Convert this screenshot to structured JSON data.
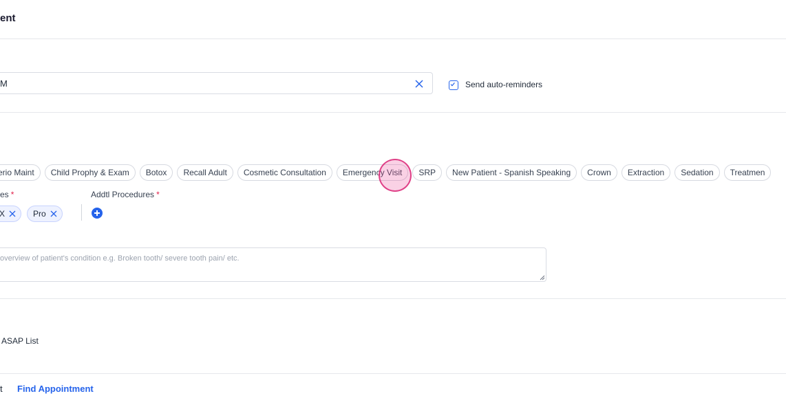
{
  "header": {
    "title": "ent"
  },
  "time_field": {
    "value": "M"
  },
  "reminders": {
    "label": "Send auto-reminders",
    "checked": true
  },
  "appointment_types": [
    "Perio Maint",
    "Child Prophy & Exam",
    "Botox",
    "Recall Adult",
    "Cosmetic Consultation",
    "Emergency Visit",
    "SRP",
    "New Patient - Spanish Speaking",
    "Crown",
    "Extraction",
    "Sedation",
    "Treatmen"
  ],
  "procedures": {
    "label": "es",
    "required_mark": "*",
    "tags": [
      "MX",
      "Pro"
    ]
  },
  "addtl_procedures": {
    "label": "Addtl Procedures",
    "required_mark": "*"
  },
  "notes": {
    "placeholder": "overview of patient's condition e.g. Broken tooth/ severe tooth pain/ etc."
  },
  "asap": {
    "label": "ASAP List"
  },
  "footer": {
    "left_text": "t",
    "link": "Find Appointment"
  },
  "colors": {
    "accent": "#2563eb",
    "required": "#e11d48",
    "cursor": "#db2777"
  }
}
